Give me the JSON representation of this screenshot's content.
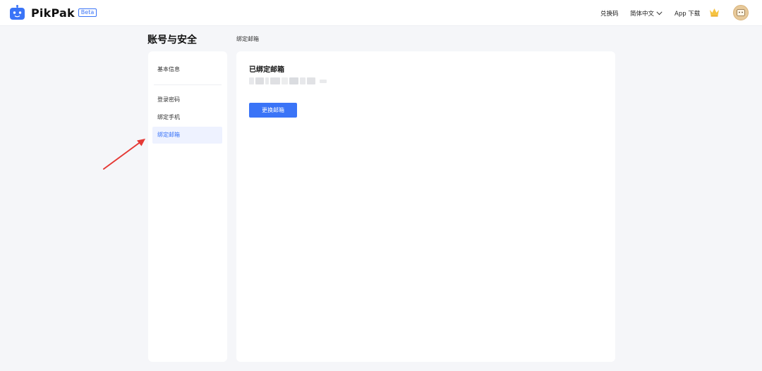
{
  "header": {
    "brand": "PikPak",
    "badge": "Beta",
    "redeem_label": "兑换码",
    "language_label": "简体中文",
    "app_download_label": "App 下载",
    "icons": [
      "pikpak-logo-icon",
      "chevron-down-icon",
      "crown-icon",
      "avatar"
    ]
  },
  "page": {
    "title": "账号与安全",
    "breadcrumb": "绑定邮箱"
  },
  "sidebar": {
    "items": [
      {
        "label": "基本信息",
        "active": false
      },
      {
        "label": "登录密码",
        "active": false
      },
      {
        "label": "绑定手机",
        "active": false
      },
      {
        "label": "绑定邮箱",
        "active": true
      }
    ]
  },
  "main": {
    "title": "已绑定邮箱",
    "change_button_label": "更换邮箱"
  },
  "colors": {
    "accent": "#3a74f7",
    "annotation_arrow": "#e53935",
    "background": "#f5f6f9"
  }
}
